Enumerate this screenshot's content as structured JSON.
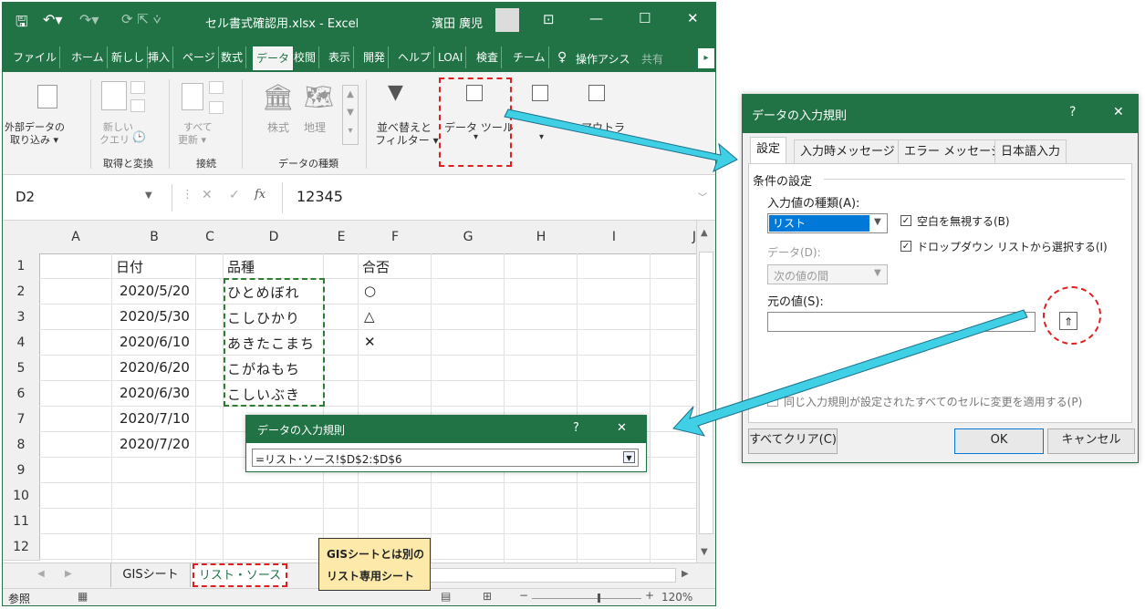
{
  "excel": {
    "title": "セル書式確認用.xlsx - Excel",
    "user": "濱田 廣児",
    "tabs": [
      "ファイル",
      "ホーム",
      "新しし",
      "挿入",
      "ページ",
      "数式",
      "データ",
      "校閲",
      "表示",
      "開発",
      "ヘルプ",
      "LOAI",
      "検査",
      "チーム"
    ],
    "tell_me": "操作アシス",
    "share": "共有",
    "ribbon": {
      "ext_data": [
        "外部データの",
        "取り込み ▾"
      ],
      "new_query": [
        "新しい",
        "クエリ ▾"
      ],
      "refresh": [
        "すべて",
        "更新 ▾"
      ],
      "stocks": "株式",
      "geo": "地理",
      "sort_filter": [
        "並べ替えと",
        "フィルター ▾"
      ],
      "data_tools": "データ ツール",
      "outline": "アウトラ",
      "group_get": "取得と変換",
      "group_conn": "接続",
      "group_types": "データの種類"
    },
    "name_box": "D2",
    "fx": "fx",
    "formula": "12345",
    "columns": [
      "A",
      "B",
      "C",
      "D",
      "E",
      "F",
      "G",
      "H",
      "I",
      "J"
    ],
    "rows": [
      "1",
      "2",
      "3",
      "4",
      "5",
      "6",
      "7",
      "8",
      "9",
      "10",
      "11",
      "12"
    ],
    "cells": {
      "B": [
        "日付",
        "2020/5/20",
        "2020/5/30",
        "2020/6/10",
        "2020/6/20",
        "2020/6/30",
        "2020/7/10",
        "2020/7/20"
      ],
      "D": [
        "品種",
        "ひとめぼれ",
        "こしひかり",
        "あきたこまち",
        "こがねもち",
        "こしいぶき"
      ],
      "F": [
        "合否",
        "○",
        "△",
        "✕"
      ]
    },
    "sheets": [
      "GISシート",
      "リスト・ソース"
    ],
    "status": "参照",
    "zoom": "120%"
  },
  "callout": {
    "line1": "GISシートとは別の",
    "line2": "リスト専用シート"
  },
  "range_dialog": {
    "title": "データの入力規則",
    "help": "?",
    "close": "✕",
    "value": "=リスト･ソース!$D$2:$D$6"
  },
  "dialog": {
    "title": "データの入力規則",
    "help": "?",
    "close": "✕",
    "tabs": [
      "設定",
      "入力時メッセージ",
      "エラー メッセージ",
      "日本語入力"
    ],
    "section": "条件の設定",
    "allow_label": "入力値の種類(A):",
    "allow_value": "リスト",
    "ignore_blank": "空白を無視する(B)",
    "dropdown": "ドロップダウン リストから選択する(I)",
    "data_label": "データ(D):",
    "data_value": "次の値の間",
    "source_label": "元の値(S):",
    "source_value": "",
    "apply_all": "同じ入力規則が設定されたすべてのセルに変更を適用する(P)",
    "clear_all": "すべてクリア(C)",
    "ok": "OK",
    "cancel": "キャンセル"
  },
  "colors": {
    "excel_green": "#217346",
    "highlight_arrow": "#3fd0e6",
    "dash_red": "#e02020",
    "dash_green": "#2e7d32",
    "callout_bg": "#fde9a9"
  }
}
